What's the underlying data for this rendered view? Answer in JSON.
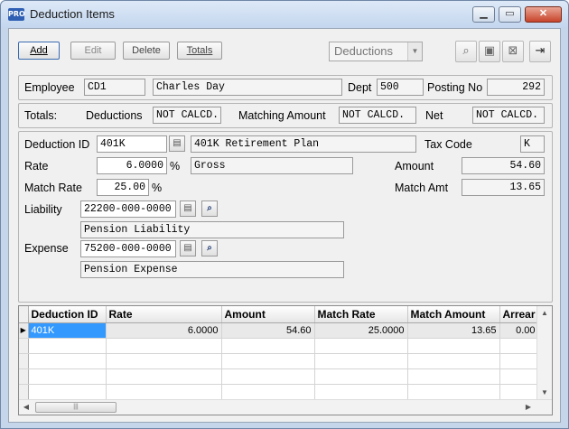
{
  "window": {
    "title": "Deduction Items",
    "icon_text": "PRO"
  },
  "toolbar": {
    "add_label": "Add",
    "edit_label": "Edit",
    "delete_label": "Delete",
    "totals_label": "Totals",
    "combo_value": "Deductions"
  },
  "header": {
    "employee_label": "Employee",
    "employee_code": "CD1",
    "employee_name": "Charles Day",
    "dept_label": "Dept",
    "dept_value": "500",
    "posting_label": "Posting No",
    "posting_value": "292"
  },
  "totals": {
    "label": "Totals:",
    "deductions_label": "Deductions",
    "deductions_value": "NOT CALCD.",
    "matching_label": "Matching Amount",
    "matching_value": "NOT CALCD.",
    "net_label": "Net",
    "net_value": "NOT CALCD."
  },
  "detail": {
    "deduction_id_label": "Deduction ID",
    "deduction_id": "401K",
    "deduction_desc": "401K Retirement Plan",
    "tax_code_label": "Tax Code",
    "tax_code": "K",
    "rate_label": "Rate",
    "rate": "6.0000",
    "rate_unit": "%",
    "rate_basis": "Gross",
    "amount_label": "Amount",
    "amount": "54.60",
    "match_rate_label": "Match Rate",
    "match_rate": "25.00",
    "match_rate_unit": "%",
    "match_amt_label": "Match Amt",
    "match_amt": "13.65",
    "liability_label": "Liability",
    "liability_account": "22200-000-0000",
    "liability_desc": "Pension Liability",
    "expense_label": "Expense",
    "expense_account": "75200-000-0000",
    "expense_desc": "Pension Expense"
  },
  "grid": {
    "columns": [
      "Deduction ID",
      "Rate",
      "Amount",
      "Match Rate",
      "Match Amount",
      "Arrear"
    ],
    "rows": [
      {
        "id": "401K",
        "rate": "6.0000",
        "amount": "54.60",
        "match_rate": "25.0000",
        "match_amount": "13.65",
        "arrear": "0.00"
      }
    ]
  }
}
